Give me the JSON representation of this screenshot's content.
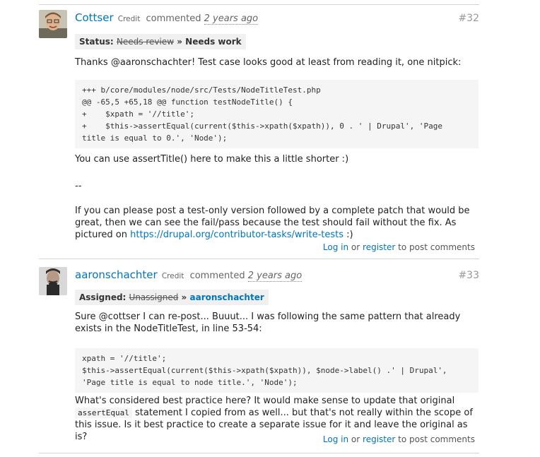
{
  "comments": [
    {
      "username": "Cottser",
      "credit": "Credit",
      "action": "commented",
      "time": "2 years ago",
      "number": "#32",
      "status_label": "Status:",
      "status_old": "Needs review",
      "status_sep": "»",
      "status_new": "Needs work",
      "intro": "Thanks @aaronschachter! Test case looks good at least from reading it, one nitpick:",
      "code": [
        "+++ b/core/modules/node/src/Tests/NodeTitleTest.php",
        "@@ -65,5 +65,18 @@ function testNodeTitle() {",
        "+    $xpath = '//title';",
        "+    $this->assertEqual(current($this->xpath($xpath)), 0 . ' | Drupal', 'Page",
        "title is equal to 0.', 'Node');"
      ],
      "after_code": "You can use assertTitle() here to make this a little shorter :)",
      "separator": "--",
      "closing": "If you can please post a test-only version followed by a complete patch that would be great, then we can see the fail/pass because the test should fail without the fix. As pictured on",
      "closing_link": "https://drupal.org/contributor-tasks/write-tests",
      "closing_end": ":)",
      "login": "Log in",
      "or": "or",
      "register": "register",
      "post": "to post comments"
    },
    {
      "username": "aaronschachter",
      "credit": "Credit",
      "action": "commented",
      "time": "2 years ago",
      "number": "#33",
      "status_label": "Assigned:",
      "status_old": "Unassigned",
      "status_sep": "»",
      "status_new": "aaronschachter",
      "intro": "Sure @cottser I can re-post... Buuut... I was following the same pattern that already exists in the NodeTitleTest, in line 53-54:",
      "code": [
        "xpath = '//title';",
        "$this->assertEqual(current($this->xpath($xpath)), $node->label() .' | Drupal',",
        "'Page title is equal to node title.', 'Node');"
      ],
      "q_start": "What's considered best practice here? It would make sense to update that original",
      "q_code": "assertEqual",
      "q_end": "statement I copied from as well... but that's not really within the scope of this issue. Is it best practice to create a separate issue for it and leave the original as is?",
      "login": "Log in",
      "or": "or",
      "register": "register",
      "post": "to post comments"
    }
  ]
}
